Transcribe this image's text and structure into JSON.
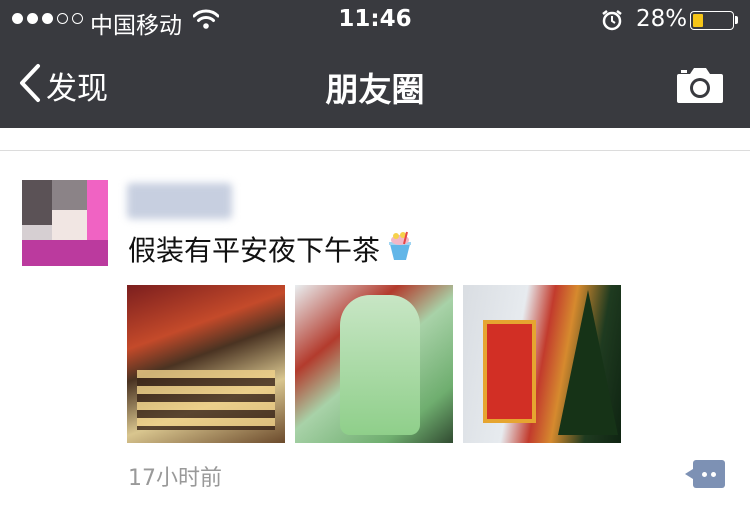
{
  "status_bar": {
    "carrier": "中国移动",
    "time": "11:46",
    "battery_percent": "28%",
    "battery_level": 0.28,
    "signal_bars_filled": 3,
    "signal_bars_total": 5,
    "icons": [
      "wifi-icon",
      "alarm-icon",
      "battery-icon"
    ]
  },
  "nav": {
    "back_label": "发现",
    "title": "朋友圈",
    "right_icon": "camera-icon"
  },
  "post": {
    "text": "假装有平安夜下午茶",
    "emoji": "cake-cup-emoji",
    "photo_count": 3,
    "photos": [
      "photo-dessert-table",
      "photo-green-cake",
      "photo-christmas-tree"
    ],
    "timestamp": "17小时前",
    "comment_icon": "comment-icon"
  },
  "colors": {
    "nav_background": "#393a3f",
    "comment_button": "#7d91b4",
    "battery_fill": "#f5c518",
    "timestamp_text": "#999999"
  }
}
